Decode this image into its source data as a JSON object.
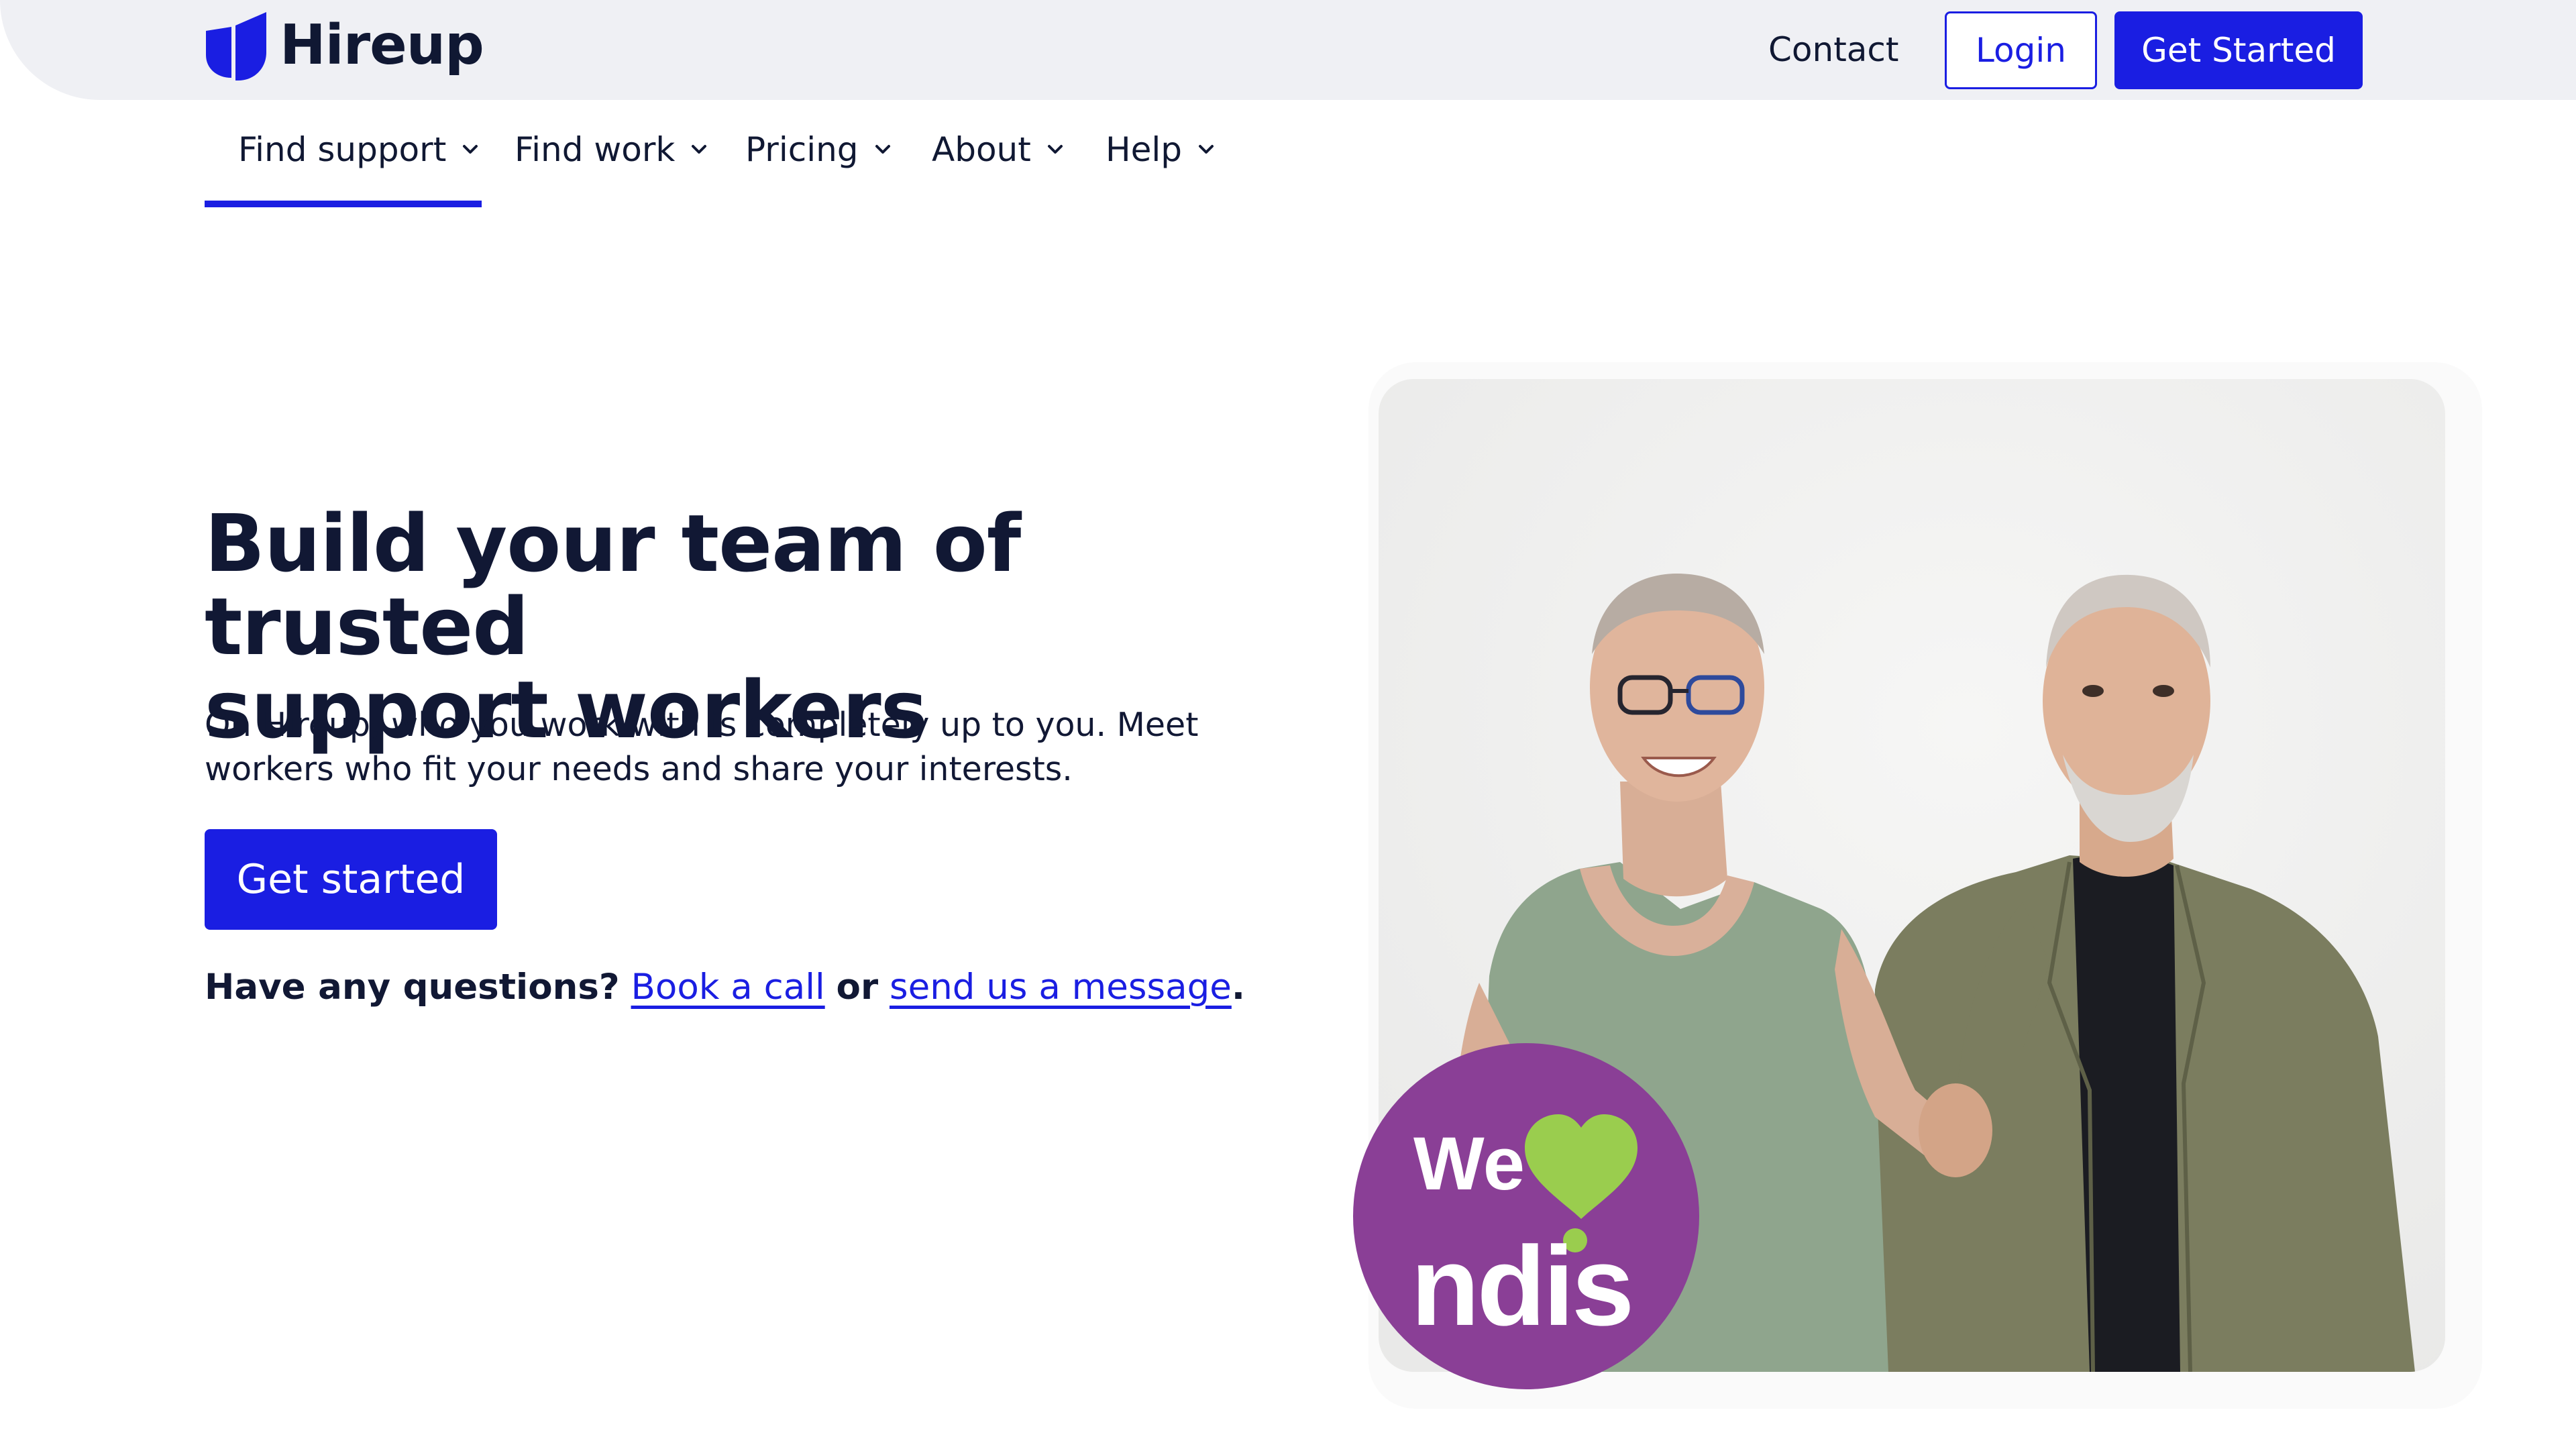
{
  "brand": {
    "name": "Hireup",
    "color": "#1a1ee2"
  },
  "header": {
    "contact_label": "Contact",
    "login_label": "Login",
    "get_started_label": "Get Started"
  },
  "nav": {
    "items": [
      {
        "label": "Find support",
        "active": true
      },
      {
        "label": "Find work"
      },
      {
        "label": "Pricing"
      },
      {
        "label": "About"
      },
      {
        "label": "Help"
      }
    ]
  },
  "hero": {
    "title_line1": "Build your team of trusted",
    "title_line2": "support workers",
    "subtitle_line1": "On Hireup, who you work with is completely up to you. Meet",
    "subtitle_line2": "workers who fit your needs and share your interests.",
    "cta_label": "Get started",
    "questions_prefix": "Have any questions?",
    "book_call_label": "Book a call",
    "or_label": "or",
    "message_label": "send us a message",
    "period": "."
  },
  "badge": {
    "word_we": "We",
    "word_ndis": "ndis",
    "bg_color": "#8a3f96",
    "heart_color": "#9acd4e"
  },
  "icons": {
    "logo": "hireup-logo-icon",
    "chevron": "chevron-down-icon",
    "heart": "heart-icon"
  }
}
